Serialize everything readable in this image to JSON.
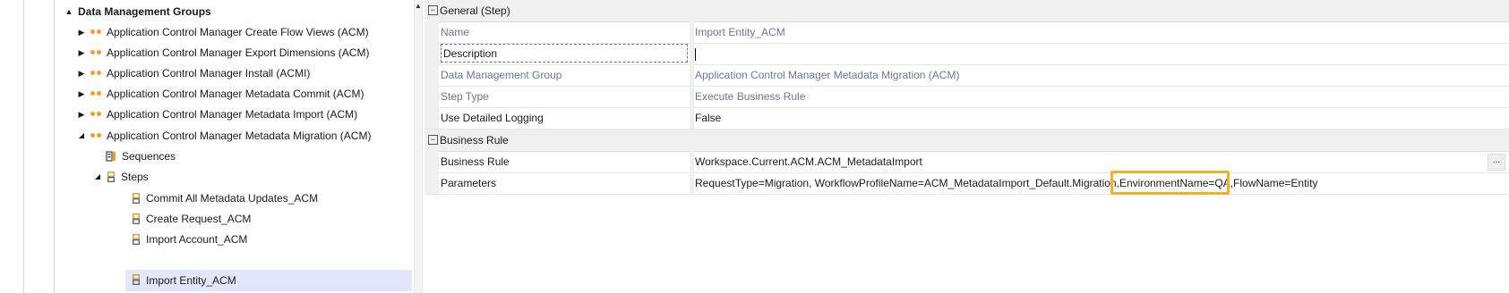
{
  "tree": {
    "root": {
      "label": "Data Management Groups",
      "expander": "▲"
    },
    "groups": [
      {
        "label": "Application Control Manager Create Flow Views (ACM)",
        "expander": "▶"
      },
      {
        "label": "Application Control Manager Export Dimensions (ACM)",
        "expander": "▶"
      },
      {
        "label": "Application Control Manager Install (ACMI)",
        "expander": "▶"
      },
      {
        "label": "Application Control Manager Metadata Commit (ACM)",
        "expander": "▶"
      },
      {
        "label": "Application Control Manager Metadata Import (ACM)",
        "expander": "▶"
      },
      {
        "label": "Application Control Manager Metadata Migration (ACM)",
        "expander": "◢"
      }
    ],
    "sequences_label": "Sequences",
    "steps_label": "Steps",
    "steps_expander": "◢",
    "steps": [
      {
        "label": "Commit All Metadata Updates_ACM"
      },
      {
        "label": "Create Request_ACM"
      },
      {
        "label": "Import Account_ACM"
      },
      {
        "label": "Import Entity_ACM"
      }
    ]
  },
  "splitter_arrow": "▲",
  "properties": {
    "general": {
      "category": "General (Step)",
      "toggle": "−",
      "rows": [
        {
          "name": "Name",
          "value": "Import Entity_ACM"
        },
        {
          "name": "Description",
          "value": ""
        },
        {
          "name": "Data Management Group",
          "value": "Application Control Manager Metadata Migration (ACM)"
        },
        {
          "name": "Step Type",
          "value": "Execute Business Rule"
        },
        {
          "name": "Use Detailed Logging",
          "value": "False"
        }
      ]
    },
    "business_rule": {
      "category": "Business Rule",
      "toggle": "−",
      "rows": [
        {
          "name": "Business Rule",
          "value": "Workspace.Current.ACM.ACM_MetadataImport",
          "button": "..."
        },
        {
          "name": "Parameters",
          "value": "RequestType=Migration, WorkflowProfileName=ACM_MetadataImport_Default.Migration,EnvironmentName=QA,FlowName=Entity"
        }
      ]
    }
  },
  "colors": {
    "accent_dots": "#f2a024",
    "highlight": "#f0b323",
    "selected_row": "#e3e7fb"
  }
}
